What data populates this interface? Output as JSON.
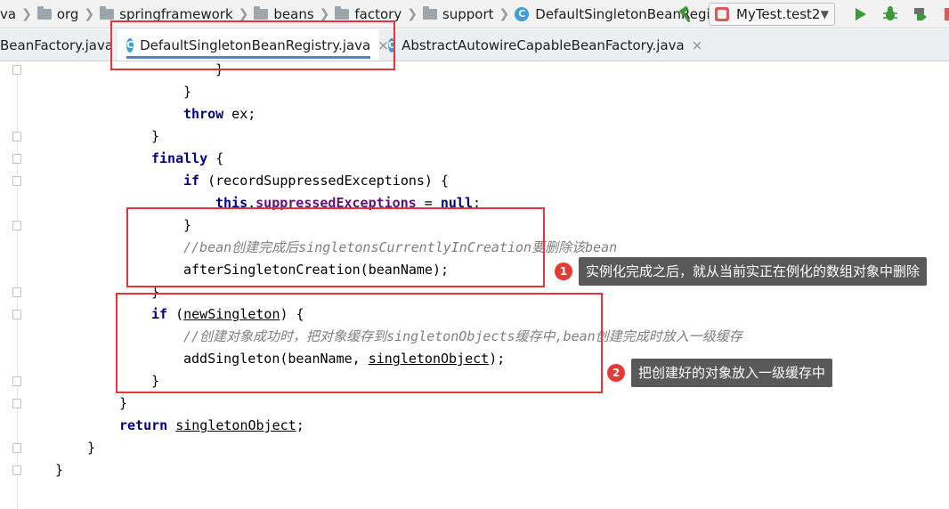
{
  "breadcrumb": {
    "items": [
      {
        "label": "va",
        "icon": "none"
      },
      {
        "label": "org",
        "icon": "folder-icon"
      },
      {
        "label": "springframework",
        "icon": "folder-icon"
      },
      {
        "label": "beans",
        "icon": "folder-icon"
      },
      {
        "label": "factory",
        "icon": "folder-icon"
      },
      {
        "label": "support",
        "icon": "folder-icon"
      },
      {
        "label": "DefaultSingletonBeanRegistry",
        "icon": "class-icon"
      }
    ],
    "class_icon_letter": "C"
  },
  "toolbar": {
    "run_config_label": "MyTest.test2",
    "icons": [
      "hammer-icon",
      "run-icon",
      "debug-icon",
      "coverage-icon",
      "stop-icon",
      "profile-icon"
    ],
    "accent_green": "#3a9a3a"
  },
  "tabs": [
    {
      "label": "BeanFactory.java",
      "active": false,
      "close": "×"
    },
    {
      "label": "DefaultSingletonBeanRegistry.java",
      "active": true,
      "close": "×"
    },
    {
      "label": "AbstractAutowireCapableBeanFactory.java",
      "active": false,
      "close": "×"
    }
  ],
  "code": {
    "lines": [
      "}",
      "}",
      "throw ex;",
      "}",
      "finally {",
      "if (recordSuppressedExceptions) {",
      "this.suppressedExceptions = null;",
      "}",
      "//bean创建完成后singletonsCurrentlyInCreation要删除该bean",
      "afterSingletonCreation(beanName);",
      "}",
      "if (newSingleton) {",
      "//创建对象成功时，把对象缓存到singletonObjects缓存中,bean创建完成时放入一级缓存",
      "addSingleton(beanName, singletonObject);",
      "}",
      "}",
      "return singletonObject;",
      "}",
      "}"
    ]
  },
  "annotations": [
    {
      "number": "1",
      "text": "实例化完成之后，就从当前实正在例化的数组对象中删除"
    },
    {
      "number": "2",
      "text": "把创建好的对象放入一级缓存中"
    }
  ],
  "colors": {
    "highlight_red": "#e5343a",
    "badge_red": "#e53935",
    "tooltip_bg": "#595959",
    "keyword": "#000080",
    "comment": "#808080",
    "field": "#660e7a"
  }
}
